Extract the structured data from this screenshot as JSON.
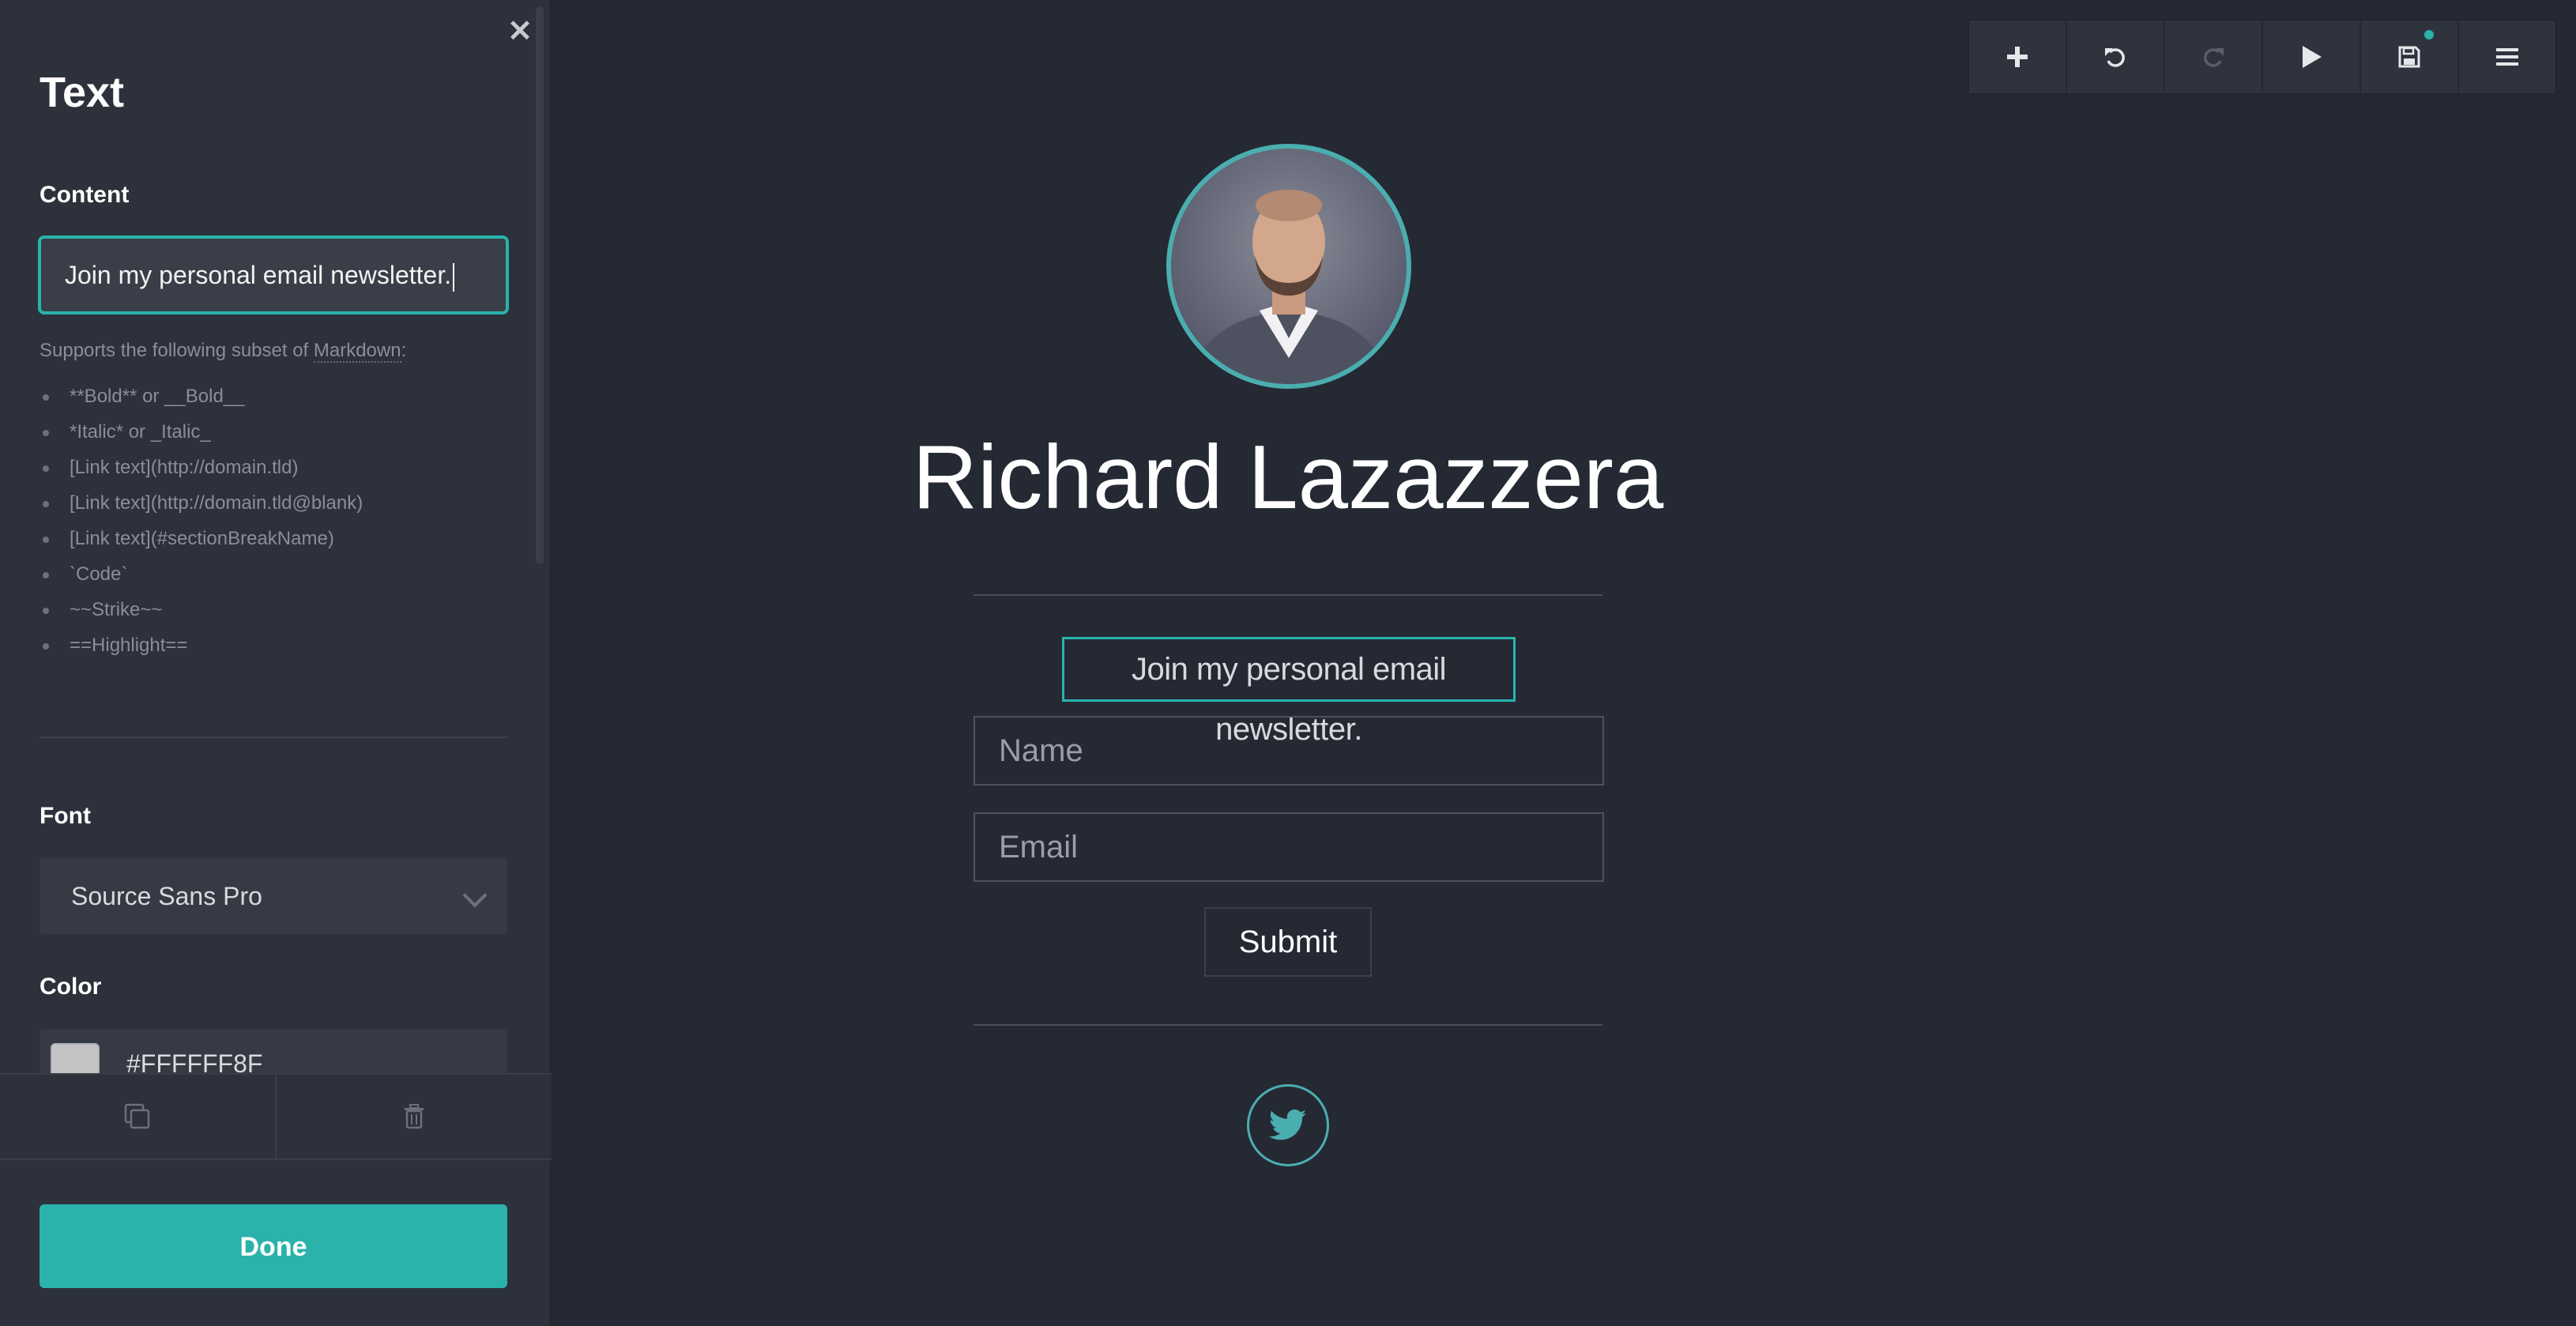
{
  "panel": {
    "close_icon": "✕",
    "title": "Text",
    "content_label": "Content",
    "content_value": "Join my personal email newsletter.",
    "markdown_note_prefix": "Supports the following subset of ",
    "markdown_link": "Markdown",
    "markdown_note_suffix": ":",
    "markdown_items": [
      "**Bold** or __Bold__",
      "*Italic* or _Italic_",
      "[Link text](http://domain.tld)",
      "[Link text](http://domain.tld@blank)",
      "[Link text](#sectionBreakName)",
      "`Code`",
      "~~Strike~~",
      "==Highlight=="
    ],
    "font_label": "Font",
    "font_value": "Source Sans Pro",
    "color_label": "Color",
    "color_value": "#FFFFFF8F",
    "done_label": "Done",
    "icons": {
      "duplicate": "duplicate-icon",
      "delete": "trash-icon"
    }
  },
  "toolbar": {
    "buttons": [
      "add-icon",
      "undo-icon",
      "redo-icon",
      "play-icon",
      "save-icon",
      "menu-icon"
    ]
  },
  "profile": {
    "name": "Richard Lazazzera",
    "newsletter_text": "Join my personal email newsletter.",
    "name_placeholder": "Name",
    "email_placeholder": "Email",
    "submit_label": "Submit",
    "social_icon": "twitter-icon"
  },
  "colors": {
    "accent": "#2ab2ab",
    "background": "#252933",
    "sidebar": "#2d313b"
  }
}
